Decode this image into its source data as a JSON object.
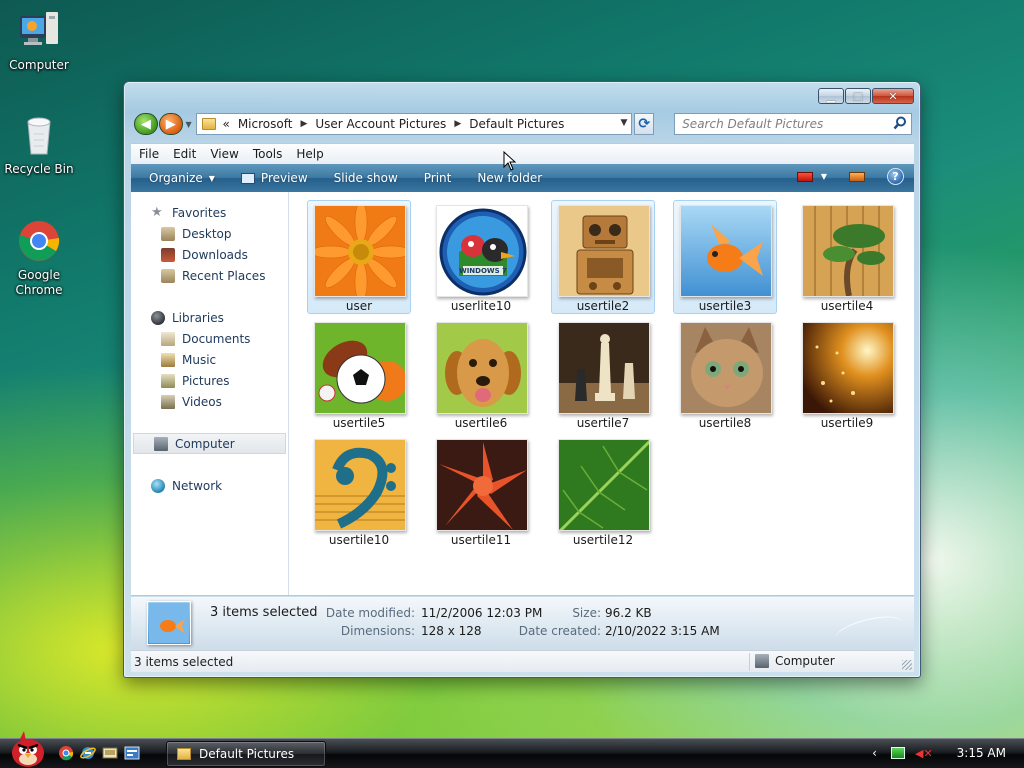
{
  "desktop": {
    "icons": [
      {
        "label": "Computer"
      },
      {
        "label": "Recycle Bin"
      },
      {
        "label": "Google Chrome"
      }
    ]
  },
  "window": {
    "title": "Default Pictures",
    "address": {
      "overflow": "«",
      "crumbs": [
        "Microsoft",
        "User Account Pictures",
        "Default Pictures"
      ]
    },
    "search": {
      "placeholder": "Search Default Pictures"
    },
    "menu": [
      "File",
      "Edit",
      "View",
      "Tools",
      "Help"
    ],
    "toolbar": {
      "organize": "Organize",
      "preview": "Preview",
      "slideshow": "Slide show",
      "print": "Print",
      "new_folder": "New folder",
      "help": "?"
    },
    "nav": {
      "favorites": "Favorites",
      "desktop": "Desktop",
      "downloads": "Downloads",
      "recent": "Recent Places",
      "libraries": "Libraries",
      "documents": "Documents",
      "music": "Music",
      "pictures": "Pictures",
      "videos": "Videos",
      "computer": "Computer",
      "network": "Network"
    },
    "files": [
      {
        "name": "user",
        "selected": true
      },
      {
        "name": "userlite10",
        "selected": false
      },
      {
        "name": "usertile2",
        "selected": true
      },
      {
        "name": "usertile3",
        "selected": true
      },
      {
        "name": "usertile4",
        "selected": false
      },
      {
        "name": "usertile5",
        "selected": false
      },
      {
        "name": "usertile6",
        "selected": false
      },
      {
        "name": "usertile7",
        "selected": false
      },
      {
        "name": "usertile8",
        "selected": false
      },
      {
        "name": "usertile9",
        "selected": false
      },
      {
        "name": "usertile10",
        "selected": false
      },
      {
        "name": "usertile11",
        "selected": false
      },
      {
        "name": "usertile12",
        "selected": false
      }
    ],
    "details": {
      "title": "3 items selected",
      "date_modified_label": "Date modified:",
      "date_modified": "11/2/2006 12:03 PM",
      "dimensions_label": "Dimensions:",
      "dimensions": "128 x 128",
      "size_label": "Size:",
      "size": "96.2 KB",
      "date_created_label": "Date created:",
      "date_created": "2/10/2022 3:15 AM"
    },
    "status": {
      "left": "3 items selected",
      "right": "Computer"
    }
  },
  "taskbar": {
    "task": "Default Pictures",
    "clock": "3:15 AM",
    "tray_chevron": "‹"
  },
  "colors": {
    "command_bar": "#3e7aa4",
    "selection_fill": "#d5e9f8",
    "selection_border": "#a9d3f3",
    "nav_text": "#1e395b"
  }
}
